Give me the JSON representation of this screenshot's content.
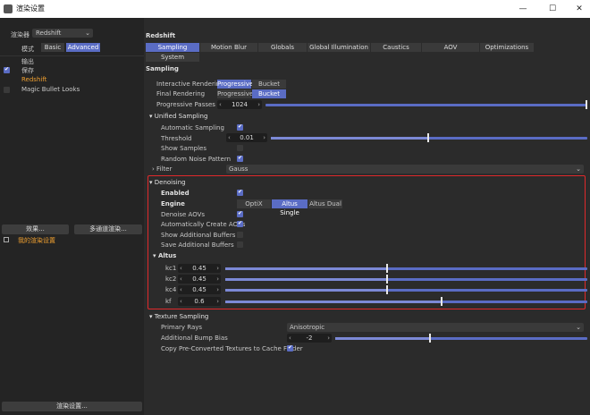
{
  "window": {
    "title": "渲染设置",
    "min": "—",
    "max": "☐",
    "close": "✕"
  },
  "left": {
    "renderer_label": "渲染器",
    "renderer_value": "Redshift",
    "mode_label": "模式",
    "mode_basic": "Basic",
    "mode_advanced": "Advanced",
    "tree": [
      "输出",
      "保存",
      "Redshift",
      "Magic Bullet Looks"
    ],
    "effect_btn": "效果...",
    "multipass_btn": "多通道渲染...",
    "my_settings": "我的渲染设置",
    "footer_btn": "渲染设置..."
  },
  "right": {
    "title": "Redshift",
    "tabs_row1": [
      "Sampling",
      "Motion Blur",
      "Globals",
      "Global Illumination",
      "Caustics",
      "AOV",
      "Optimizations"
    ],
    "tabs_row2": [
      "System"
    ],
    "section": "Sampling",
    "interactive_label": "Interactive Rendering",
    "final_label": "Final Rendering",
    "progressive": "Progressive",
    "bucket": "Bucket",
    "passes_label": "Progressive Passes",
    "passes_value": "1024",
    "unified": {
      "title": "Unified Sampling",
      "auto_label": "Automatic Sampling",
      "threshold_label": "Threshold",
      "threshold_value": "0.01",
      "show_samples_label": "Show Samples",
      "random_label": "Random Noise Pattern",
      "filter_label": "Filter",
      "filter_value": "Gauss"
    },
    "denoising": {
      "title": "Denoising",
      "enabled_label": "Enabled",
      "engine_label": "Engine",
      "engines": [
        "OptiX",
        "Altus Single",
        "Altus Dual"
      ],
      "aovs_label": "Denoise AOVs",
      "auto_aovs_label": "Automatically Create AOVs",
      "show_buf_label": "Show Additional Buffers",
      "save_buf_label": "Save Additional Buffers"
    },
    "altus": {
      "title": "Altus",
      "params": [
        {
          "label": "kc1",
          "value": "0.45",
          "frac": 0.45
        },
        {
          "label": "kc2",
          "value": "0.45",
          "frac": 0.45
        },
        {
          "label": "kc4",
          "value": "0.45",
          "frac": 0.45
        },
        {
          "label": "kf",
          "value": "0.6",
          "frac": 0.6
        }
      ]
    },
    "texture": {
      "title": "Texture Sampling",
      "primary_label": "Primary Rays",
      "primary_value": "Anisotropic",
      "bump_label": "Additional Bump Bias",
      "bump_value": "-2",
      "cache_label": "Copy Pre-Converted Textures to Cache Folder"
    }
  },
  "colors": {
    "accent": "#5a6cc4",
    "highlight_border": "#e0292b",
    "orange_text": "#f0a030"
  }
}
